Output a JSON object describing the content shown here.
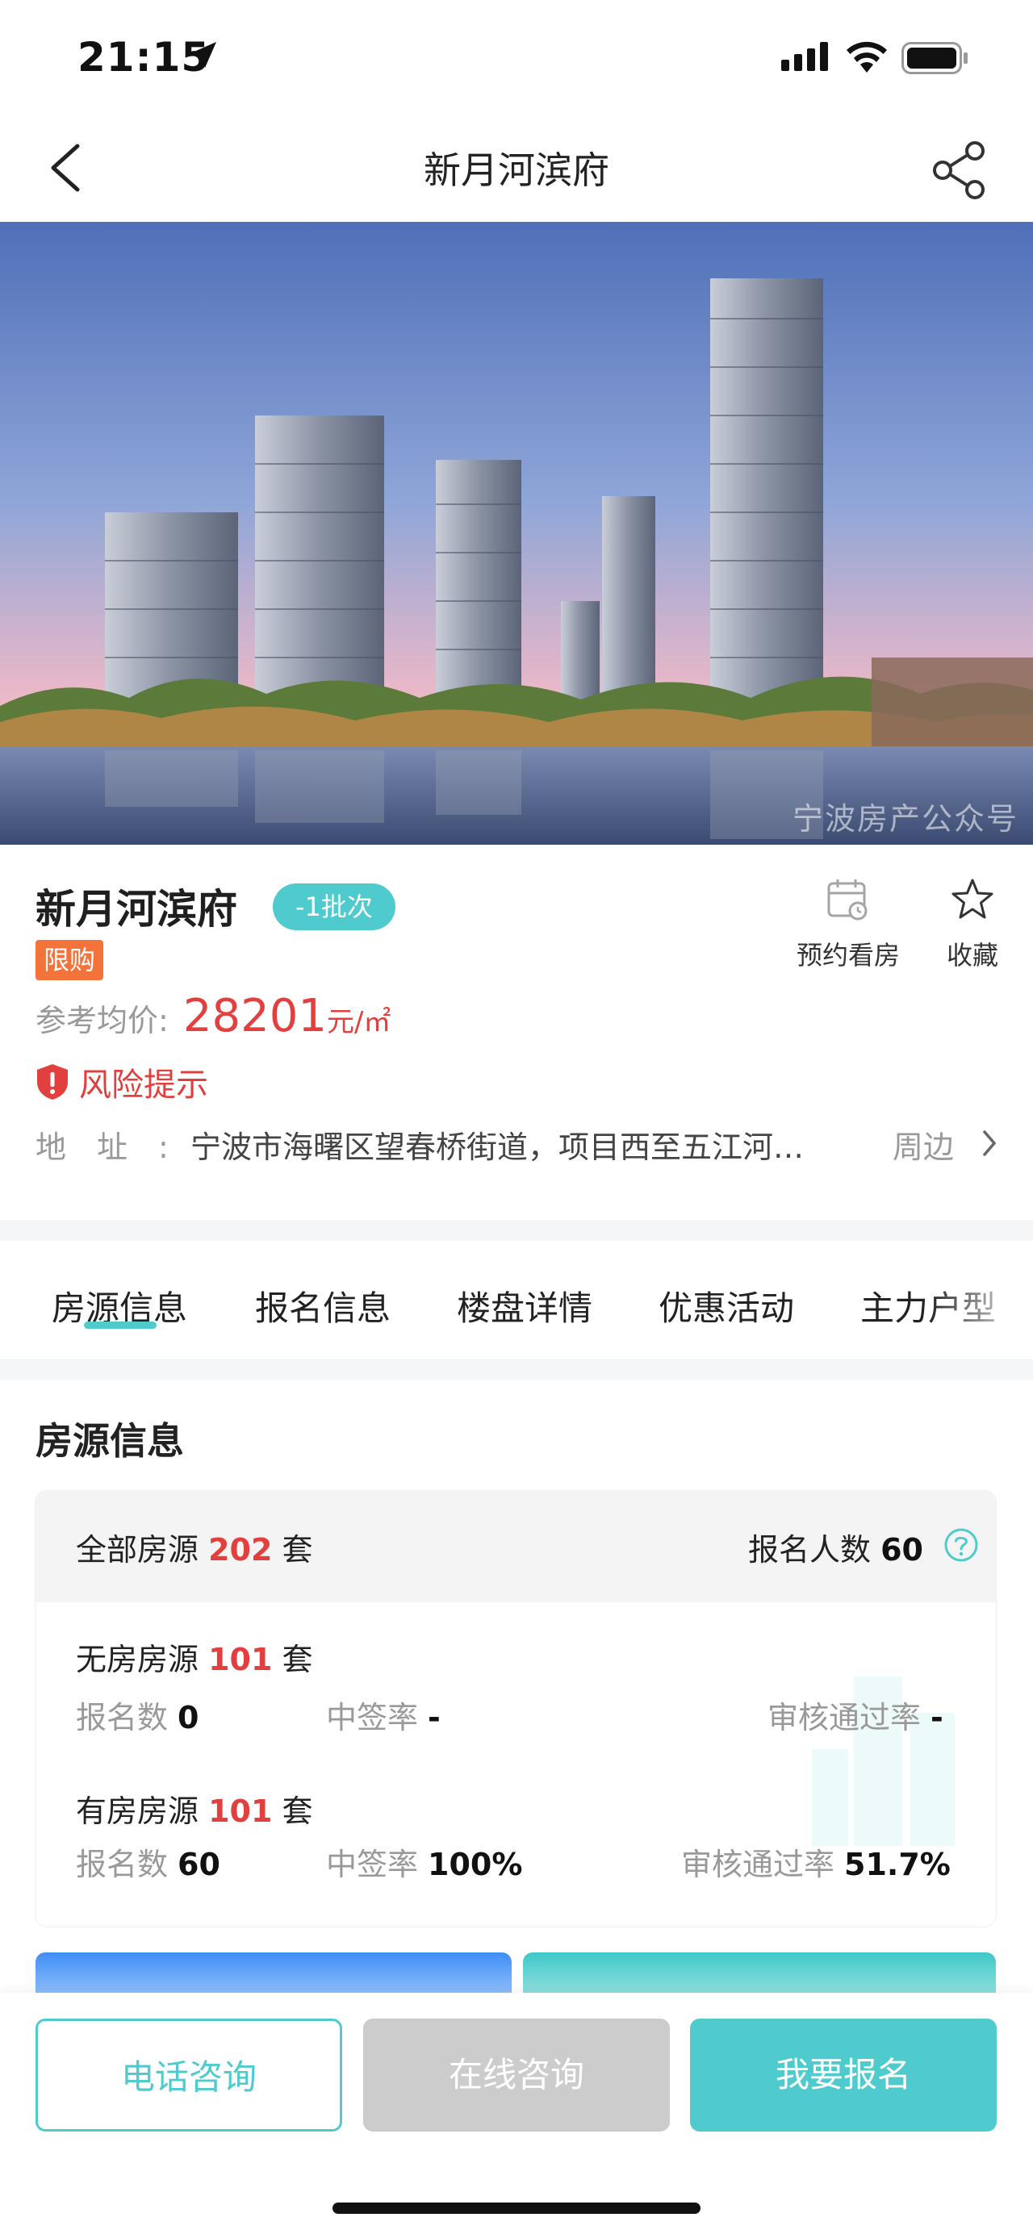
{
  "status_bar": {
    "time": "21:15"
  },
  "nav": {
    "title": "新月河滨府"
  },
  "hero": {
    "watermark": "宁波房产公众号"
  },
  "project": {
    "name": "新月河滨府",
    "batch_badge": "-1批次",
    "tag": "限购",
    "actions": {
      "visit_label": "预约看房",
      "favorite_label": "收藏"
    },
    "price_label": "参考均价:",
    "price_value": "28201",
    "price_unit": "元/㎡",
    "risk_label": "风险提示",
    "address_label": "地址:",
    "address_value": "宁波市海曙区望春桥街道，项目西至五江河…",
    "address_more": "周边"
  },
  "tabs": [
    "房源信息",
    "报名信息",
    "楼盘详情",
    "优惠活动",
    "主力户型"
  ],
  "source_info": {
    "title": "房源信息",
    "all_label": "全部房源",
    "all_count": "202",
    "unit": "套",
    "applicants_label": "报名人数",
    "applicants_count": "60",
    "groups": [
      {
        "label": "无房房源",
        "count": "101",
        "unit": "套",
        "signup_label": "报名数",
        "signup_value": "0",
        "win_label": "中签率",
        "win_value": "-",
        "pass_label": "审核通过率",
        "pass_value": "-"
      },
      {
        "label": "有房房源",
        "count": "101",
        "unit": "套",
        "signup_label": "报名数",
        "signup_value": "60",
        "win_label": "中签率",
        "win_value": "100%",
        "pass_label": "审核通过率",
        "pass_value": "51.7%"
      }
    ]
  },
  "bottom_bar": {
    "phone_label": "电话咨询",
    "online_label": "在线咨询",
    "signup_label": "我要报名"
  },
  "colors": {
    "accent": "#4fcacd",
    "price_red": "#e2403e",
    "tag_orange": "#f4733b",
    "disabled_gray": "#cccccc"
  }
}
